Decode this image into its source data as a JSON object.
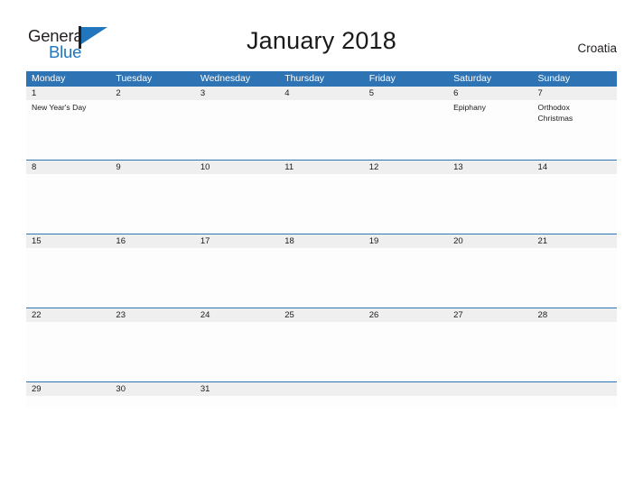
{
  "logo": {
    "word_one": "General",
    "word_two": "Blue",
    "icon": "flag-triangle-icon",
    "brand_blue": "#2176bd",
    "brand_dark": "#231f20"
  },
  "header": {
    "title": "January 2018",
    "country": "Croatia"
  },
  "calendar": {
    "header_color": "#2e74b5",
    "date_band_color": "#efefef",
    "weekday_headers": [
      "Monday",
      "Tuesday",
      "Wednesday",
      "Thursday",
      "Friday",
      "Saturday",
      "Sunday"
    ],
    "weeks": [
      {
        "days": [
          {
            "date": "1",
            "events": [
              "New Year's Day"
            ]
          },
          {
            "date": "2",
            "events": []
          },
          {
            "date": "3",
            "events": []
          },
          {
            "date": "4",
            "events": []
          },
          {
            "date": "5",
            "events": []
          },
          {
            "date": "6",
            "events": [
              "Epiphany"
            ]
          },
          {
            "date": "7",
            "events": [
              "Orthodox",
              "Christmas"
            ]
          }
        ]
      },
      {
        "days": [
          {
            "date": "8",
            "events": []
          },
          {
            "date": "9",
            "events": []
          },
          {
            "date": "10",
            "events": []
          },
          {
            "date": "11",
            "events": []
          },
          {
            "date": "12",
            "events": []
          },
          {
            "date": "13",
            "events": []
          },
          {
            "date": "14",
            "events": []
          }
        ]
      },
      {
        "days": [
          {
            "date": "15",
            "events": []
          },
          {
            "date": "16",
            "events": []
          },
          {
            "date": "17",
            "events": []
          },
          {
            "date": "18",
            "events": []
          },
          {
            "date": "19",
            "events": []
          },
          {
            "date": "20",
            "events": []
          },
          {
            "date": "21",
            "events": []
          }
        ]
      },
      {
        "days": [
          {
            "date": "22",
            "events": []
          },
          {
            "date": "23",
            "events": []
          },
          {
            "date": "24",
            "events": []
          },
          {
            "date": "25",
            "events": []
          },
          {
            "date": "26",
            "events": []
          },
          {
            "date": "27",
            "events": []
          },
          {
            "date": "28",
            "events": []
          }
        ]
      },
      {
        "days": [
          {
            "date": "29",
            "events": []
          },
          {
            "date": "30",
            "events": []
          },
          {
            "date": "31",
            "events": []
          },
          {
            "date": "",
            "events": []
          },
          {
            "date": "",
            "events": []
          },
          {
            "date": "",
            "events": []
          },
          {
            "date": "",
            "events": []
          }
        ]
      }
    ]
  }
}
